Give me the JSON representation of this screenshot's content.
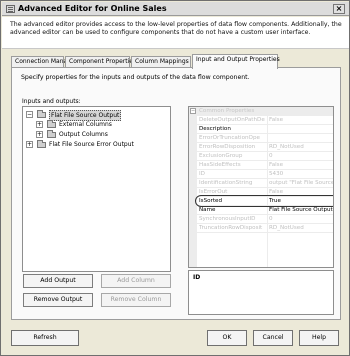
{
  "window": {
    "title": "Advanced Editor for Online Sales",
    "description": "The advanced editor provides access to the low-level properties of data flow components. Additionally, the advanced editor can be used to configure components that do not have a custom user interface."
  },
  "tabs": [
    {
      "label": "Connection Managers"
    },
    {
      "label": "Component Properties"
    },
    {
      "label": "Column Mappings"
    },
    {
      "label": "Input and Output Properties"
    }
  ],
  "panel": {
    "instruction": "Specify properties for the inputs and outputs of the data flow component.",
    "inputs_outputs_label": "Inputs and outputs:"
  },
  "tree": [
    {
      "label": "Flat File Source Output",
      "expander": "−"
    },
    {
      "label": "External Columns",
      "expander": "+"
    },
    {
      "label": "Output Columns",
      "expander": "+"
    },
    {
      "label": "Flat File Source Error Output",
      "expander": "+"
    }
  ],
  "buttons": {
    "add_output": "Add Output",
    "add_column": "Add Column",
    "remove_output": "Remove Output",
    "remove_column": "Remove Column"
  },
  "properties": {
    "category": "Common Properties",
    "rows": [
      {
        "key": "DeleteOutputOnPathDe",
        "value": "False"
      },
      {
        "key": "Description",
        "value": ""
      },
      {
        "key": "ErrorOrTruncationOpe",
        "value": ""
      },
      {
        "key": "ErrorRowDisposition",
        "value": "RD_NotUsed"
      },
      {
        "key": "ExclusionGroup",
        "value": "0"
      },
      {
        "key": "HasSideEffects",
        "value": "False"
      },
      {
        "key": "ID",
        "value": "5430"
      },
      {
        "key": "IdentificationString",
        "value": "output \"Flat File Source Outpu"
      },
      {
        "key": "IsErrorOut",
        "value": "False"
      },
      {
        "key": "IsSorted",
        "value": "True"
      },
      {
        "key": "Name",
        "value": "Flat File Source Output"
      },
      {
        "key": "SynchronousInputID",
        "value": "0"
      },
      {
        "key": "TruncationRowDisposit",
        "value": "RD_NotUsed"
      }
    ],
    "help_title": "ID"
  },
  "footer": {
    "refresh": "Refresh",
    "ok": "OK",
    "cancel": "Cancel",
    "help": "Help"
  }
}
